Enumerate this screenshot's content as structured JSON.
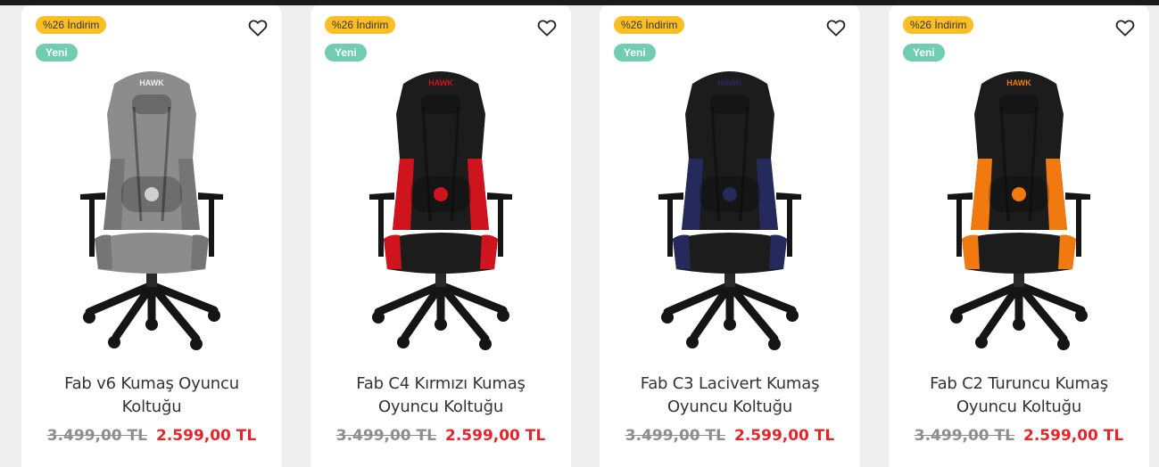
{
  "products": [
    {
      "discount_badge": "%26 İndirim",
      "new_badge": "Yeni",
      "name": "Fab v6 Kumaş Oyuncu Koltuğu",
      "old_price": "3.499,00 TL",
      "new_price": "2.599,00 TL",
      "body_color": "#8c8c8c",
      "accent_color": "#757575",
      "logo": "HAWK"
    },
    {
      "discount_badge": "%26 İndirim",
      "new_badge": "Yeni",
      "name": "Fab C4 Kırmızı Kumaş Oyuncu Koltuğu",
      "old_price": "3.499,00 TL",
      "new_price": "2.599,00 TL",
      "body_color": "#1c1c1c",
      "accent_color": "#d0141e",
      "logo": "HAWK"
    },
    {
      "discount_badge": "%26 İndirim",
      "new_badge": "Yeni",
      "name": "Fab C3 Lacivert Kumaş Oyuncu Koltuğu",
      "old_price": "3.499,00 TL",
      "new_price": "2.599,00 TL",
      "body_color": "#1c1c1c",
      "accent_color": "#252a5c",
      "logo": "HAWK"
    },
    {
      "discount_badge": "%26 İndirim",
      "new_badge": "Yeni",
      "name": "Fab C2 Turuncu Kumaş Oyuncu Koltuğu",
      "old_price": "3.499,00 TL",
      "new_price": "2.599,00 TL",
      "body_color": "#1c1c1c",
      "accent_color": "#f07a10",
      "logo": "HAWK"
    }
  ],
  "icons": {
    "favorite": "heart-outline-icon"
  }
}
